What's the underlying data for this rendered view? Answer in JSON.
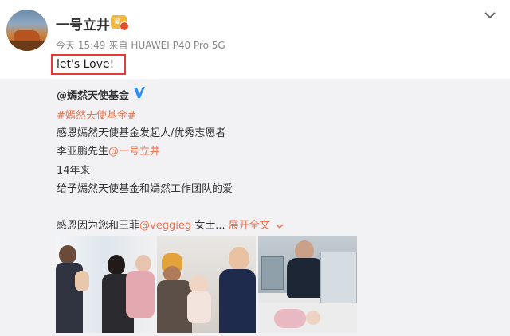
{
  "post": {
    "username": "一号立井",
    "meta": {
      "time": "今天 15:49",
      "source_prefix": "来自",
      "device": "HUAWEI P40 Pro 5G"
    },
    "text": "let's Love!"
  },
  "repost": {
    "author": "@嫣然天使基金",
    "lines": {
      "hashtag": "#嫣然天使基金#",
      "line2": "感恩嫣然天使基金发起人/优秀志愿者",
      "line3_prefix": "李亚鹏先生",
      "line3_mention": "@一号立井",
      "line4": "14年来",
      "line5": "给予嫣然天使基金和嫣然工作团队的爱",
      "line6_prefix": "感恩因为您和王菲",
      "line6_mention": "@veggieg",
      "line6_suffix": " 女士...",
      "expand": "展开全文"
    }
  },
  "colors": {
    "link": "#eb7350",
    "highlight_border": "#e8383d",
    "repost_bg": "#f2f2f5",
    "verified": "#2a8ff7"
  },
  "icons": {
    "vip": "vip-crown-icon",
    "menu": "chevron-down-icon",
    "verified": "verified-v-icon",
    "expand": "chevron-down-icon"
  }
}
